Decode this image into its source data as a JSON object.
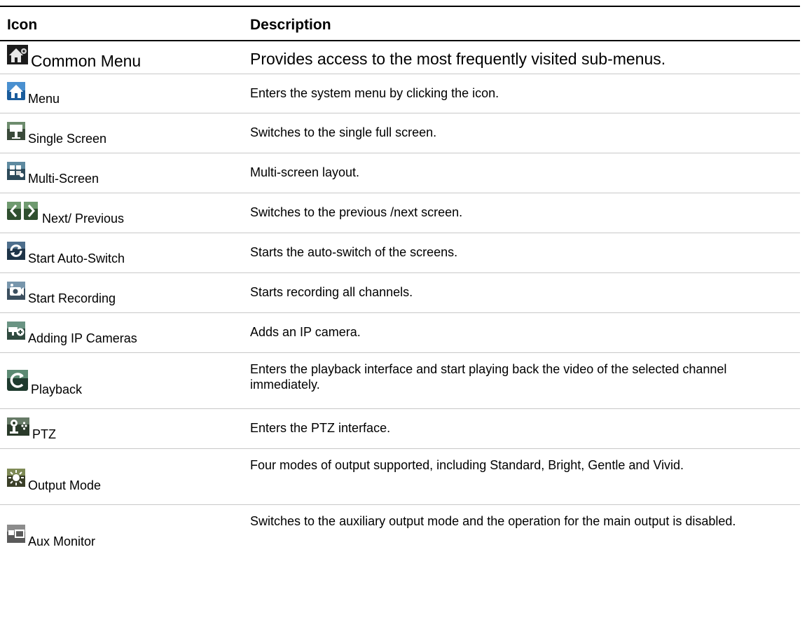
{
  "header": {
    "icon_col": "Icon",
    "desc_col": "Description"
  },
  "rows": [
    {
      "label": "Common Menu",
      "icon": "home-gear-icon",
      "desc": "Provides access to the most frequently visited sub-menus."
    },
    {
      "label": "Menu",
      "icon": "home-icon",
      "desc": "Enters the system menu by clicking the icon."
    },
    {
      "label": "Single Screen",
      "icon": "single-screen-icon",
      "desc": "Switches to the single full screen."
    },
    {
      "label": "Multi-Screen",
      "icon": "multi-screen-icon",
      "desc": "Multi-screen layout."
    },
    {
      "label": "Next/ Previous",
      "icon": "prev-next-arrows-icon",
      "desc": "Switches to the previous /next screen."
    },
    {
      "label": "Start Auto-Switch",
      "icon": "auto-switch-icon",
      "desc": "Starts the auto-switch of the screens."
    },
    {
      "label": "Start Recording",
      "icon": "recording-icon",
      "desc": "Starts recording all channels."
    },
    {
      "label": "Adding IP Cameras",
      "icon": "ip-camera-icon",
      "desc": "Adds an IP camera."
    },
    {
      "label": "Playback",
      "icon": "playback-icon",
      "desc": "Enters the playback interface and start playing back the video of the selected channel immediately."
    },
    {
      "label": "PTZ",
      "icon": "ptz-icon",
      "desc": "Enters the PTZ interface."
    },
    {
      "label": "Output Mode",
      "icon": "output-mode-icon",
      "desc": "Four modes of output supported, including Standard, Bright, Gentle and Vivid."
    },
    {
      "label": "Aux Monitor",
      "icon": "aux-monitor-icon",
      "desc": "Switches to the auxiliary output mode and the operation for the main output is disabled."
    }
  ]
}
